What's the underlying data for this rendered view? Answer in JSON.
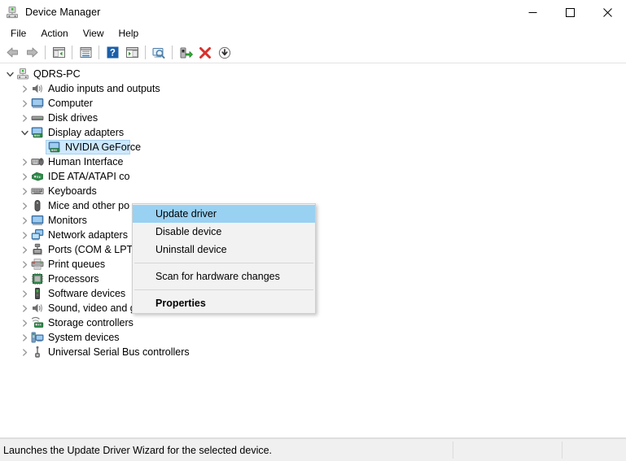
{
  "window": {
    "title": "Device Manager",
    "app_icon": "device-manager-icon",
    "controls": {
      "minimize": "minimize-icon",
      "maximize": "maximize-icon",
      "close": "close-icon"
    }
  },
  "menubar": {
    "items": [
      {
        "label": "File"
      },
      {
        "label": "Action"
      },
      {
        "label": "View"
      },
      {
        "label": "Help"
      }
    ]
  },
  "toolbar": {
    "buttons": [
      {
        "icon": "back-arrow-icon",
        "title": "Back"
      },
      {
        "icon": "forward-arrow-icon",
        "title": "Forward"
      },
      {
        "sep": true
      },
      {
        "icon": "show-hide-console-tree-icon",
        "title": "Show/Hide Console Tree"
      },
      {
        "sep": true
      },
      {
        "icon": "properties-icon",
        "title": "Properties"
      },
      {
        "sep": true
      },
      {
        "icon": "help-icon",
        "title": "Help"
      },
      {
        "icon": "show-hide-action-pane-icon",
        "title": "Show/Hide Action Pane"
      },
      {
        "sep": true
      },
      {
        "icon": "scan-computer-icon",
        "title": "Scan for hardware changes"
      },
      {
        "sep": true
      },
      {
        "icon": "update-driver-icon",
        "title": "Update driver"
      },
      {
        "icon": "uninstall-device-icon",
        "title": "Uninstall device"
      },
      {
        "icon": "disable-device-icon",
        "title": "Disable device"
      }
    ]
  },
  "tree": {
    "root": {
      "label": "QDRS-PC",
      "icon": "computer-root-icon",
      "expanded": true,
      "indent": 0
    },
    "nodes": [
      {
        "label": "Audio inputs and outputs",
        "icon": "speaker-icon",
        "expanded": false,
        "indent": 1
      },
      {
        "label": "Computer",
        "icon": "monitor-icon",
        "expanded": false,
        "indent": 1
      },
      {
        "label": "Disk drives",
        "icon": "disk-drive-icon",
        "expanded": false,
        "indent": 1
      },
      {
        "label": "Display adapters",
        "icon": "display-adapter-icon",
        "expanded": true,
        "indent": 1
      },
      {
        "label": "NVIDIA GeForce",
        "icon": "display-adapter-icon",
        "expanded": null,
        "indent": 2,
        "selected": true
      },
      {
        "label": "Human Interface",
        "icon": "human-interface-icon",
        "expanded": false,
        "indent": 1
      },
      {
        "label": "IDE ATA/ATAPI co",
        "icon": "ide-controller-icon",
        "expanded": false,
        "indent": 1
      },
      {
        "label": "Keyboards",
        "icon": "keyboard-icon",
        "expanded": false,
        "indent": 1
      },
      {
        "label": "Mice and other po",
        "icon": "mouse-icon",
        "expanded": false,
        "indent": 1
      },
      {
        "label": "Monitors",
        "icon": "monitor-icon",
        "expanded": false,
        "indent": 1
      },
      {
        "label": "Network adapters",
        "icon": "network-adapter-icon",
        "expanded": false,
        "indent": 1
      },
      {
        "label": "Ports (COM & LPT)",
        "icon": "port-icon",
        "expanded": false,
        "indent": 1
      },
      {
        "label": "Print queues",
        "icon": "printer-icon",
        "expanded": false,
        "indent": 1
      },
      {
        "label": "Processors",
        "icon": "processor-icon",
        "expanded": false,
        "indent": 1
      },
      {
        "label": "Software devices",
        "icon": "software-device-icon",
        "expanded": false,
        "indent": 1
      },
      {
        "label": "Sound, video and game controllers",
        "icon": "speaker-icon",
        "expanded": false,
        "indent": 1
      },
      {
        "label": "Storage controllers",
        "icon": "storage-controller-icon",
        "expanded": false,
        "indent": 1
      },
      {
        "label": "System devices",
        "icon": "system-device-icon",
        "expanded": false,
        "indent": 1
      },
      {
        "label": "Universal Serial Bus controllers",
        "icon": "usb-icon",
        "expanded": false,
        "indent": 1
      }
    ]
  },
  "context_menu": {
    "items": [
      {
        "label": "Update driver",
        "highlight": true,
        "bold": false
      },
      {
        "label": "Disable device",
        "highlight": false,
        "bold": false
      },
      {
        "label": "Uninstall device",
        "highlight": false,
        "bold": false
      },
      {
        "sep": true
      },
      {
        "label": "Scan for hardware changes",
        "highlight": false,
        "bold": false
      },
      {
        "sep": true
      },
      {
        "label": "Properties",
        "highlight": false,
        "bold": true
      }
    ]
  },
  "statusbar": {
    "text": "Launches the Update Driver Wizard for the selected device.",
    "segments": [
      0,
      556,
      690
    ]
  },
  "colors": {
    "selection_blue": "#cde8ff",
    "menu_highlight": "#99d1f2",
    "titlebar_bg": "#ffffff",
    "statusbar_bg": "#f0f0f0",
    "menu_bg": "#f2f2f2"
  }
}
